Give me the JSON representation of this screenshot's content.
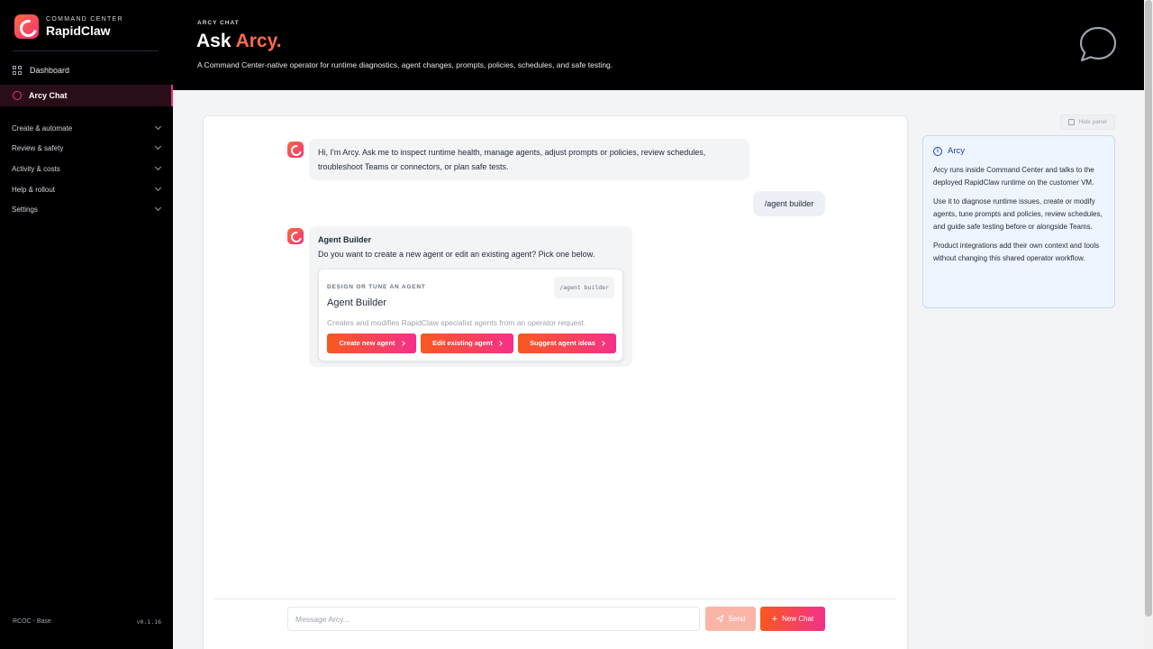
{
  "brand": {
    "subtitle": "COMMAND CENTER",
    "name": "RapidClaw"
  },
  "sidebar": {
    "items": [
      {
        "label": "Dashboard",
        "icon": "grid-icon"
      },
      {
        "label": "Arcy Chat",
        "icon": "chat-icon",
        "active": true
      }
    ],
    "sections": [
      {
        "label": "Create & automate"
      },
      {
        "label": "Review & safety"
      },
      {
        "label": "Activity & costs"
      },
      {
        "label": "Help & rollout"
      },
      {
        "label": "Settings"
      }
    ],
    "footer": {
      "env": "RCOC - Base",
      "version": "v0.1.16"
    }
  },
  "header": {
    "eyebrow": "ARCY CHAT",
    "title_prefix": "Ask ",
    "title_accent": "Arcy.",
    "subtitle": "A Command Center-native operator for runtime diagnostics, agent changes, prompts, policies, schedules, and safe testing."
  },
  "chat": {
    "messages": [
      {
        "role": "assistant",
        "text": "Hi, I'm Arcy. Ask me to inspect runtime health, manage agents, adjust prompts or policies, review schedules, troubleshoot Teams or connectors, or plan safe tests."
      },
      {
        "role": "user",
        "text": "/agent builder"
      },
      {
        "role": "assistant",
        "title": "Agent Builder",
        "text": "Do you want to create a new agent or edit an existing agent? Pick one below.",
        "card": {
          "eyebrow": "DESIGN OR TUNE AN AGENT",
          "command": "/agent builder",
          "title": "Agent Builder",
          "description": "Creates and modifies RapidClaw specialist agents from an operator request.",
          "buttons": [
            "Create new agent",
            "Edit existing agent",
            "Suggest agent ideas"
          ]
        }
      }
    ],
    "composer": {
      "placeholder": "Message Arcy...",
      "send_label": "Send",
      "new_chat_label": "New Chat"
    }
  },
  "panel": {
    "hide_label": "Hide panel",
    "title": "Arcy",
    "paragraphs": [
      "Arcy runs inside Command Center and talks to the deployed RapidClaw runtime on the customer VM.",
      "Use it to diagnose runtime issues, create or modify agents, tune prompts and policies, review schedules, and guide safe testing before or alongside Teams.",
      "Product integrations add their own context and tools without changing this shared operator workflow."
    ]
  },
  "colors": {
    "accent": "#f0327a",
    "accent_orange": "#f9591f",
    "info_blue": "#1e40af"
  }
}
